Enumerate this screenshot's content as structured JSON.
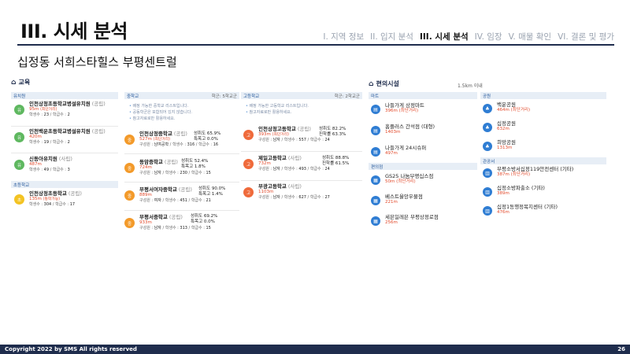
{
  "header": {
    "title": "III. 시세 분석",
    "nav": [
      "I. 지역 정보",
      "II. 입지 분석",
      "III. 시세 분석",
      "IV. 임장",
      "V. 매물 확인",
      "VI. 결론 및 평가"
    ],
    "active_index": 2,
    "subtitle": "십정동 서희스타힐스 부평센트럴"
  },
  "education": {
    "label": "교육",
    "kindergarten": {
      "label": "유치원",
      "items": [
        {
          "name": "인천상정초등학교병설유치원",
          "type": "(공립)",
          "dist": "95m",
          "dist_note": "(최단거리)",
          "meta1": "학생수 : ",
          "v1": "23",
          "meta2": " / 학급수 : ",
          "v2": "2"
        },
        {
          "name": "인천백운초등학교병설유치원",
          "type": "(공립)",
          "dist": "420m",
          "dist_note": "",
          "meta1": "학생수 : ",
          "v1": "19",
          "meta2": " / 학급수 : ",
          "v2": "2"
        },
        {
          "name": "신동아유치원",
          "type": "(사립)",
          "dist": "487m",
          "dist_note": "",
          "meta1": "학생수 : ",
          "v1": "49",
          "meta2": " / 학급수 : ",
          "v2": "3"
        }
      ]
    },
    "elementary": {
      "label": "초등학교",
      "items": [
        {
          "name": "인천상정초등학교",
          "type": "(공립)",
          "dist": "135m",
          "dist_note": "(통학가능)",
          "meta1": "학생수 : ",
          "v1": "304",
          "meta2": " / 학급수 : ",
          "v2": "17"
        }
      ]
    },
    "middle": {
      "label": "중학교",
      "right": "학군: 5학교군",
      "notes": [
        "배정 가능한 중학교 리스트입니다.",
        "공동학군은 포함되어 있지 않습니다.",
        "참고자료로만 활용하세요."
      ],
      "items": [
        {
          "name": "인천상정중학교",
          "type": "(공립)",
          "dist": "527m",
          "dist_note": "(최단거리)",
          "r1": "성취도 65.9%",
          "r2": "특목고 0.0%",
          "meta": "구성원 : ",
          "g": "남여공학",
          "m2": " / 학생수 : ",
          "v1": "316",
          "m3": " / 학급수 : ",
          "v2": "16"
        },
        {
          "name": "동암중학교",
          "type": "(공립)",
          "dist": "724m",
          "dist_note": "",
          "r1": "성취도 52.4%",
          "r2": "특목고 1.8%",
          "meta": "구성원 : ",
          "g": "남자",
          "m2": " / 학생수 : ",
          "v1": "230",
          "m3": " / 학급수 : ",
          "v2": "15"
        },
        {
          "name": "부평서여자중학교",
          "type": "(공립)",
          "dist": "889m",
          "dist_note": "",
          "r1": "성취도 90.0%",
          "r2": "특목고 1.4%",
          "meta": "구성원 : ",
          "g": "여자",
          "m2": " / 학생수 : ",
          "v1": "451",
          "m3": " / 학급수 : ",
          "v2": "21"
        },
        {
          "name": "부평서중학교",
          "type": "(공립)",
          "dist": "933m",
          "dist_note": "",
          "r1": "성취도 69.2%",
          "r2": "특목고 0.0%",
          "meta": "구성원 : ",
          "g": "남자",
          "m2": " / 학생수 : ",
          "v1": "313",
          "m3": " / 학급수 : ",
          "v2": "15"
        }
      ]
    },
    "high": {
      "label": "고등학교",
      "right": "학군: 2학교군",
      "notes": [
        "배정 가능한 고등학교 리스트입니다.",
        "참고자료로만 활용하세요."
      ],
      "items": [
        {
          "name": "인천상정고등학교",
          "type": "(공립)",
          "dist": "393m",
          "dist_note": "(최단거리)",
          "r1": "성취도 82.2%",
          "r2": "진학률 63.3%",
          "meta": "구성원 : ",
          "g": "남자",
          "m2": " / 학생수 : ",
          "v1": "557",
          "m3": " / 학급수 : ",
          "v2": "24"
        },
        {
          "name": "제일고등학교",
          "type": "(사립)",
          "dist": "732m",
          "dist_note": "",
          "r1": "성취도 88.8%",
          "r2": "진학률 61.5%",
          "meta": "구성원 : ",
          "g": "남자",
          "m2": " / 학생수 : ",
          "v1": "493",
          "m3": " / 학급수 : ",
          "v2": "24"
        },
        {
          "name": "부광고등학교",
          "type": "(사립)",
          "dist": "1103m",
          "dist_note": "",
          "r1": "",
          "r2": "",
          "meta": "구성원 : ",
          "g": "남자",
          "m2": " / 학생수 : ",
          "v1": "627",
          "m3": " / 학급수 : ",
          "v2": "27"
        }
      ]
    }
  },
  "facilities": {
    "label": "편의시설",
    "range": "1.5km 이내",
    "mart": {
      "label": "마트",
      "items": [
        {
          "name": "나들가게 상정마트",
          "dist": "396m",
          "note": "(최단거리)"
        },
        {
          "name": "홈플러스 간석점 (대형)",
          "dist": "1403m",
          "note": ""
        },
        {
          "name": "나들가게 24시슈퍼",
          "dist": "497m",
          "note": ""
        }
      ]
    },
    "convenience": {
      "label": "편의점",
      "items": [
        {
          "name": "GS25 나눔부평십스점",
          "dist": "50m",
          "note": "(최단거리)"
        },
        {
          "name": "베스트율앙우물점",
          "dist": "221m",
          "note": ""
        },
        {
          "name": "세븐일레븐 부평상정로점",
          "dist": "256m",
          "note": ""
        }
      ]
    },
    "park": {
      "label": "공원",
      "items": [
        {
          "name": "백운공원",
          "dist": "464m",
          "note": "(최단거리)"
        },
        {
          "name": "십정공원",
          "dist": "632m",
          "note": ""
        },
        {
          "name": "희망공원",
          "dist": "1313m",
          "note": ""
        }
      ]
    },
    "public": {
      "label": "관공서",
      "items": [
        {
          "name": "부평소방서십정119안전센터 (기타)",
          "dist": "387m",
          "note": "(최단거리)"
        },
        {
          "name": "십정소방파출소 (기타)",
          "dist": "389m",
          "note": ""
        },
        {
          "name": "십정1동행정복지센터 (기타)",
          "dist": "476m",
          "note": ""
        }
      ]
    }
  },
  "badges": {
    "kinder": "유",
    "elem": "초",
    "middle": "중",
    "high": "고"
  },
  "footer": {
    "copyright": "Copyright 2022 by SMS All rights reserved",
    "page": "26"
  }
}
